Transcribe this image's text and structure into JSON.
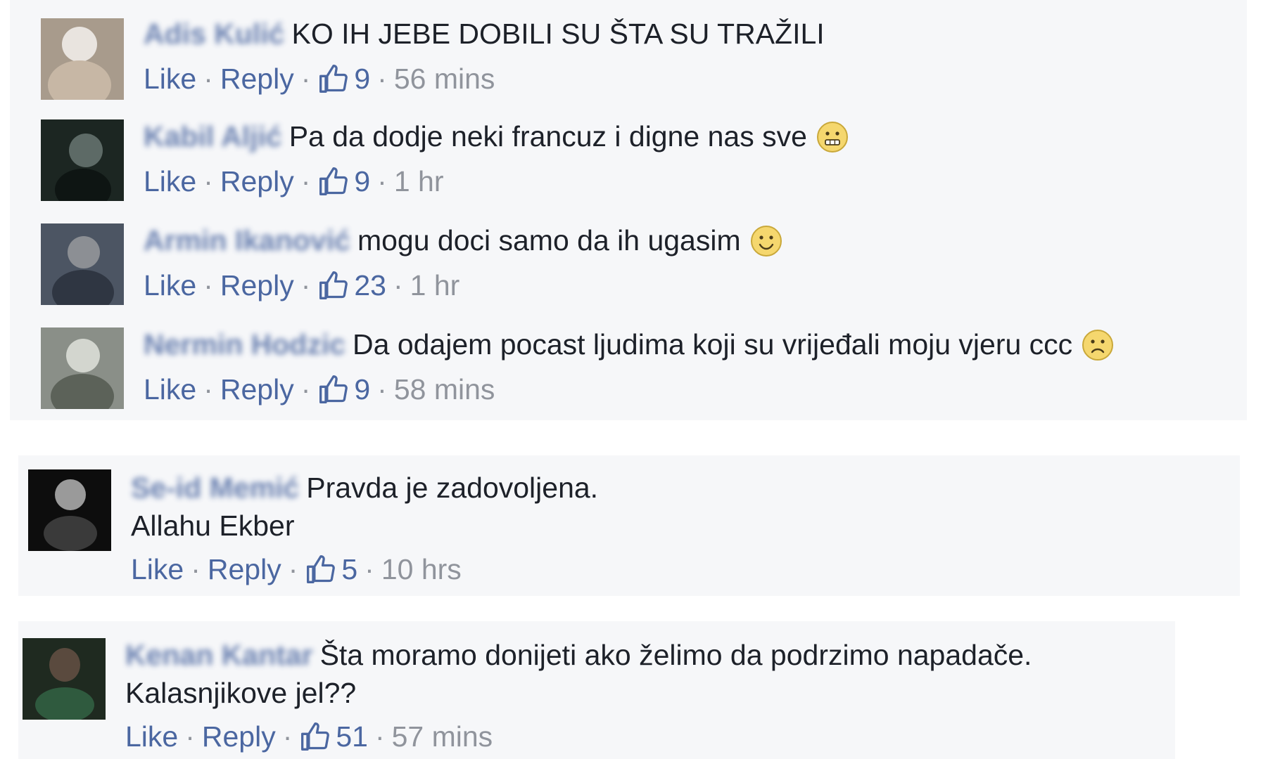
{
  "actions": {
    "like": "Like",
    "reply": "Reply",
    "separator": "·"
  },
  "comments": [
    {
      "author": "Adis Kulić",
      "text": "KO IH JEBE DOBILI SU ŠTA SU TRAŽILI",
      "likes": "9",
      "time": "56 mins",
      "avatar_icon": "avatar-icon"
    },
    {
      "author": "Kabil Aljić",
      "text": "Pa da dodje neki francuz i digne nas sve",
      "emoji": "grimace-emoji-icon",
      "likes": "9",
      "time": "1 hr",
      "avatar_icon": "avatar-icon"
    },
    {
      "author": "Armin Ikanović",
      "text": "mogu doci samo da ih ugasim",
      "emoji": "smile-emoji-icon",
      "likes": "23",
      "time": "1 hr",
      "avatar_icon": "avatar-icon"
    },
    {
      "author": "Nermin Hodzic",
      "text": "Da odajem pocast ljudima koji su vrijeđali moju vjeru ccc",
      "emoji": "frown-emoji-icon",
      "likes": "9",
      "time": "58 mins",
      "avatar_icon": "avatar-icon"
    },
    {
      "author": "Se-id Memić",
      "text": "Pravda je zadovoljena.",
      "text2": "Allahu Ekber",
      "likes": "5",
      "time": "10 hrs",
      "avatar_icon": "avatar-icon"
    },
    {
      "author": "Kenan Kantar",
      "text": "Šta moramo donijeti ako želimo da podrzimo napadače.",
      "text2": "Kalasnjikove jel??",
      "likes": "51",
      "time": "57 mins",
      "avatar_icon": "avatar-icon"
    }
  ],
  "colors": {
    "link": "#4b67a1",
    "author": "#3b5998",
    "meta": "#90949c",
    "panel": "#f6f7f9",
    "emoji": "#f5d76e"
  }
}
